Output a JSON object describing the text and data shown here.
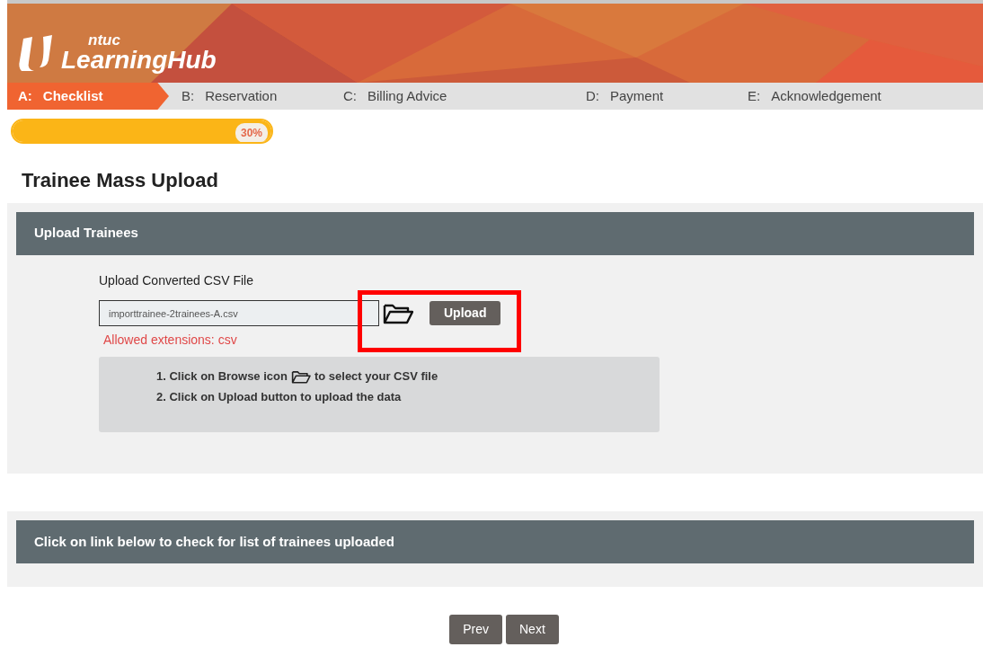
{
  "logo": {
    "small": "ntuc",
    "large": "LearningHub"
  },
  "steps": [
    {
      "letter": "A:",
      "label": "Checklist",
      "selected": true
    },
    {
      "letter": "B:",
      "label": "Reservation",
      "selected": false
    },
    {
      "letter": "C:",
      "label": "Billing Advice",
      "selected": false
    },
    {
      "letter": "D:",
      "label": "Payment",
      "selected": false
    },
    {
      "letter": "E:",
      "label": "Acknowledgement",
      "selected": false
    }
  ],
  "progress": {
    "level": 1,
    "reading": "30%"
  },
  "title": "Trainee Mass Upload",
  "upload_panel": {
    "header": "Upload Trainees",
    "field_label": "Upload Converted CSV File",
    "file_value": "importtrainee-2trainees-A.csv",
    "hint": "Allowed extensions: csv",
    "button": "Upload",
    "highlighted": true,
    "instructions": [
      {
        "before": "1. Click on Browse icon",
        "icon": true,
        "after": "to select your CSV file"
      },
      {
        "before": "2. Click on Upload button to upload the data",
        "icon": false
      }
    ]
  },
  "list_panel": {
    "header": "Click on link below to check for list of trainees uploaded"
  },
  "buttons": [
    "Prev",
    "Next"
  ]
}
